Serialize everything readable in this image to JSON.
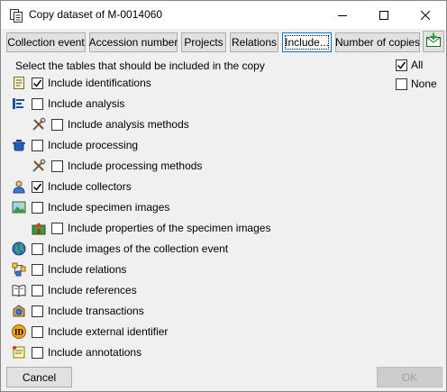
{
  "window": {
    "title": "Copy dataset of M-0014060"
  },
  "tabs": [
    {
      "label": "Collection event",
      "active": false
    },
    {
      "label": "Accession number",
      "active": false
    },
    {
      "label": "Projects",
      "active": false
    },
    {
      "label": "Relations",
      "active": false
    },
    {
      "label": "Include...",
      "active": true
    },
    {
      "label": "Number of copies",
      "active": false
    }
  ],
  "instructions": "Select the tables that should be included in the copy",
  "select": {
    "all_label": "All",
    "all_checked": true,
    "none_label": "None",
    "none_checked": false
  },
  "options": [
    {
      "label": "Include identifications",
      "checked": true,
      "icon": "identification-icon"
    },
    {
      "label": "Include analysis",
      "checked": false,
      "icon": "analysis-icon"
    },
    {
      "label": "Include analysis methods",
      "checked": false,
      "icon": "tools-icon"
    },
    {
      "label": "Include processing",
      "checked": false,
      "icon": "processing-icon"
    },
    {
      "label": "Include processing methods",
      "checked": false,
      "icon": "tools-icon"
    },
    {
      "label": "Include collectors",
      "checked": true,
      "icon": "collector-icon"
    },
    {
      "label": "Include specimen images",
      "checked": false,
      "icon": "image-icon"
    },
    {
      "label": "Include properties of the specimen images",
      "checked": false,
      "icon": "image-properties-icon"
    },
    {
      "label": "Include images of the collection event",
      "checked": false,
      "icon": "globe-icon"
    },
    {
      "label": "Include relations",
      "checked": false,
      "icon": "relations-icon"
    },
    {
      "label": "Include references",
      "checked": false,
      "icon": "book-icon"
    },
    {
      "label": "Include transactions",
      "checked": false,
      "icon": "transaction-icon"
    },
    {
      "label": "Include external identifier",
      "checked": false,
      "icon": "id-icon"
    },
    {
      "label": "Include annotations",
      "checked": false,
      "icon": "annotation-icon"
    }
  ],
  "buttons": {
    "cancel": "Cancel",
    "ok": "OK"
  }
}
